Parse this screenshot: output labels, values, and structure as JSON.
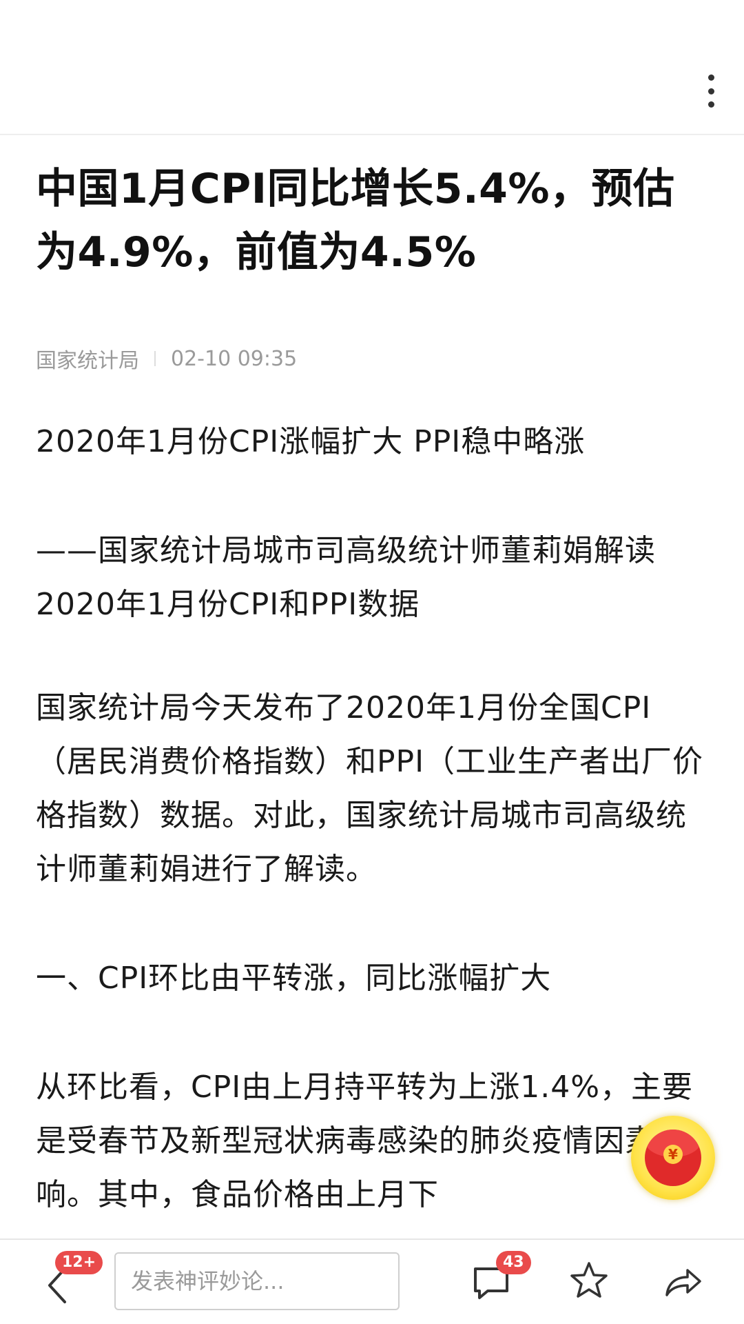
{
  "top_bar": {
    "more_icon": "more-vertical-icon"
  },
  "article": {
    "headline": "中国1月CPI同比增长5.4%，预估为4.9%，前值为4.5%",
    "source": "国家统计局",
    "timestamp": "02-10 09:35",
    "paragraphs": [
      "2020年1月份CPI涨幅扩大 PPI稳中略涨",
      "——国家统计局城市司高级统计师董莉娟解读2020年1月份CPI和PPI数据",
      "国家统计局今天发布了2020年1月份全国CPI（居民消费价格指数）和PPI（工业生产者出厂价格指数）数据。对此，国家统计局城市司高级统计师董莉娟进行了解读。",
      "一、CPI环比由平转涨，同比涨幅扩大",
      "从环比看，CPI由上月持平转为上涨1.4%，主要是受春节及新型冠状病毒感染的肺炎疫情因素影响。其中，食品价格由上月下"
    ]
  },
  "floating": {
    "red_packet_icon": "red-envelope-icon",
    "coin_symbol": "¥"
  },
  "bottom_bar": {
    "back_badge": "12+",
    "comment_placeholder": "发表神评妙论...",
    "comments_badge": "43",
    "icons": {
      "back": "chevron-left-icon",
      "comments": "comment-bubble-icon",
      "favorite": "star-icon",
      "share": "share-icon"
    }
  }
}
